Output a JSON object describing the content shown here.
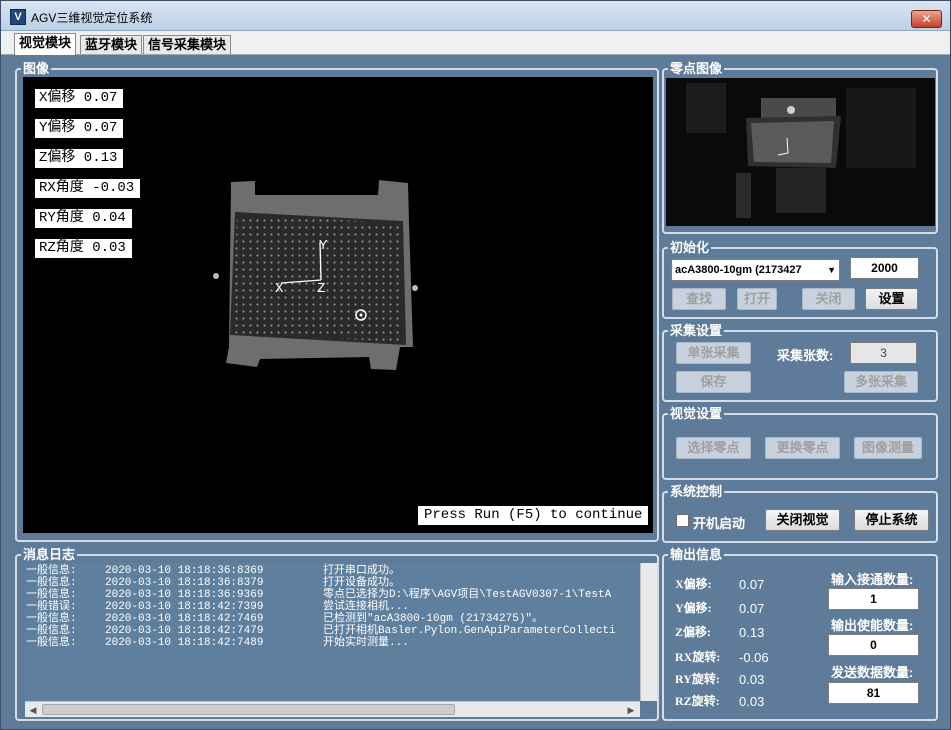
{
  "window": {
    "title": "AGV三维视觉定位系统",
    "close": "✕"
  },
  "tabs": [
    "视觉模块",
    "蓝牙模块",
    "信号采集模块"
  ],
  "image_panel": {
    "group_title": "图像",
    "labels": [
      "X偏移 0.07",
      "Y偏移 0.07",
      "Z偏移 0.13",
      "RX角度 -0.03",
      "RY角度 0.04",
      "RZ角度 0.03"
    ],
    "axis_x": "X",
    "axis_y": "Y",
    "axis_z": "Z",
    "press_run": "Press Run (F5) to continue"
  },
  "zero_image": {
    "group_title": "零点图像"
  },
  "init": {
    "group_title": "初始化",
    "camera_select": "acA3800-10gm (2173427",
    "value": "2000",
    "buttons": {
      "find": "查找",
      "open": "打开",
      "close": "关闭",
      "settings": "设置"
    }
  },
  "capture": {
    "group_title": "采集设置",
    "single": "单张采集",
    "count_label": "采集张数:",
    "count": "3",
    "save": "保存",
    "multi": "多张采集"
  },
  "vision": {
    "group_title": "视觉设置",
    "select_zero": "选择零点",
    "change_zero": "更换零点",
    "measure": "图像测量"
  },
  "system": {
    "group_title": "系统控制",
    "autostart": "开机启动",
    "close_vision": "关闭视觉",
    "stop": "停止系统"
  },
  "log": {
    "group_title": "消息日志",
    "rows": [
      {
        "level": "一般信息:",
        "time": "2020-03-10 18:18:36:8369",
        "msg": "打开串口成功。"
      },
      {
        "level": "一般信息:",
        "time": "2020-03-10 18:18:36:8379",
        "msg": "打开设备成功。"
      },
      {
        "level": "一般信息:",
        "time": "2020-03-10 18:18:36:9369",
        "msg": "零点已选择为D:\\程序\\AGV项目\\TestAGV0307-1\\TestA"
      },
      {
        "level": "一般错误:",
        "time": "2020-03-10 18:18:42:7399",
        "msg": "尝试连接相机..."
      },
      {
        "level": "一般信息:",
        "time": "2020-03-10 18:18:42:7469",
        "msg": "已检测到\"acA3800-10gm (21734275)\"。"
      },
      {
        "level": "一般信息:",
        "time": "2020-03-10 18:18:42:7479",
        "msg": "已打开相机Basler.Pylon.GenApiParameterCollecti"
      },
      {
        "level": "一般信息:",
        "time": "2020-03-10 18:18:42:7489",
        "msg": "开始实时测量..."
      }
    ]
  },
  "output": {
    "group_title": "输出信息",
    "rows": [
      {
        "label": "X偏移:",
        "value": "0.07"
      },
      {
        "label": "Y偏移:",
        "value": "0.07"
      },
      {
        "label": "Z偏移:",
        "value": "0.13"
      },
      {
        "label": "RX旋转:",
        "value": "-0.06"
      },
      {
        "label": "RY旋转:",
        "value": "0.03"
      },
      {
        "label": "RZ旋转:",
        "value": "0.03"
      }
    ],
    "input_count_label": "输入接通数量:",
    "input_count": "1",
    "output_count_label": "输出使能数量:",
    "output_count": "0",
    "send_count_label": "发送数据数量:",
    "send_count": "81"
  }
}
